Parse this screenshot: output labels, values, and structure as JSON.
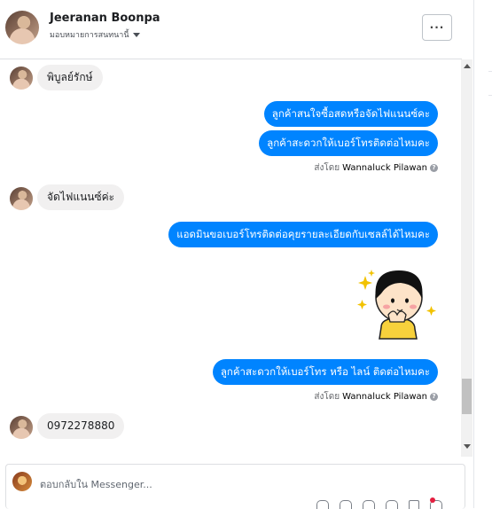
{
  "header": {
    "contact_name": "Jeeranan Boonpa",
    "assign_label": "มอบหมายการสนทนานี้",
    "more_label": "···"
  },
  "messages": [
    {
      "type": "incoming",
      "text": "พิบูลย์รักษ์"
    },
    {
      "type": "outgoing",
      "text": "ลูกค้าสนใจซื้อสดหรือจัดไฟแนนซ์คะ"
    },
    {
      "type": "outgoing",
      "text": "ลูกค้าสะดวกให้เบอร์โทรติดต่อไหมคะ"
    },
    {
      "type": "sent_by",
      "prefix": "ส่งโดย",
      "name": "Wannaluck Pilawan"
    },
    {
      "type": "incoming",
      "text": "จัดไฟแนนซ์ค่ะ"
    },
    {
      "type": "outgoing",
      "text": "แอดมินขอเบอร์โทรติดต่อคุยรายละเอียดกับเซลล์ได้ไหมคะ"
    },
    {
      "type": "sticker",
      "icon": "girl-sticker-icon"
    },
    {
      "type": "outgoing",
      "text": "ลูกค้าสะดวกให้เบอร์โทร หรือ ไลน์ ติดต่อไหมคะ"
    },
    {
      "type": "sent_by",
      "prefix": "ส่งโดย",
      "name": "Wannaluck Pilawan"
    },
    {
      "type": "incoming",
      "text": "0972278880"
    }
  ],
  "composer": {
    "placeholder": "ตอบกลับใน Messenger..."
  },
  "colors": {
    "outgoing_bubble": "#0084ff",
    "incoming_bubble": "#f1f0f0"
  }
}
